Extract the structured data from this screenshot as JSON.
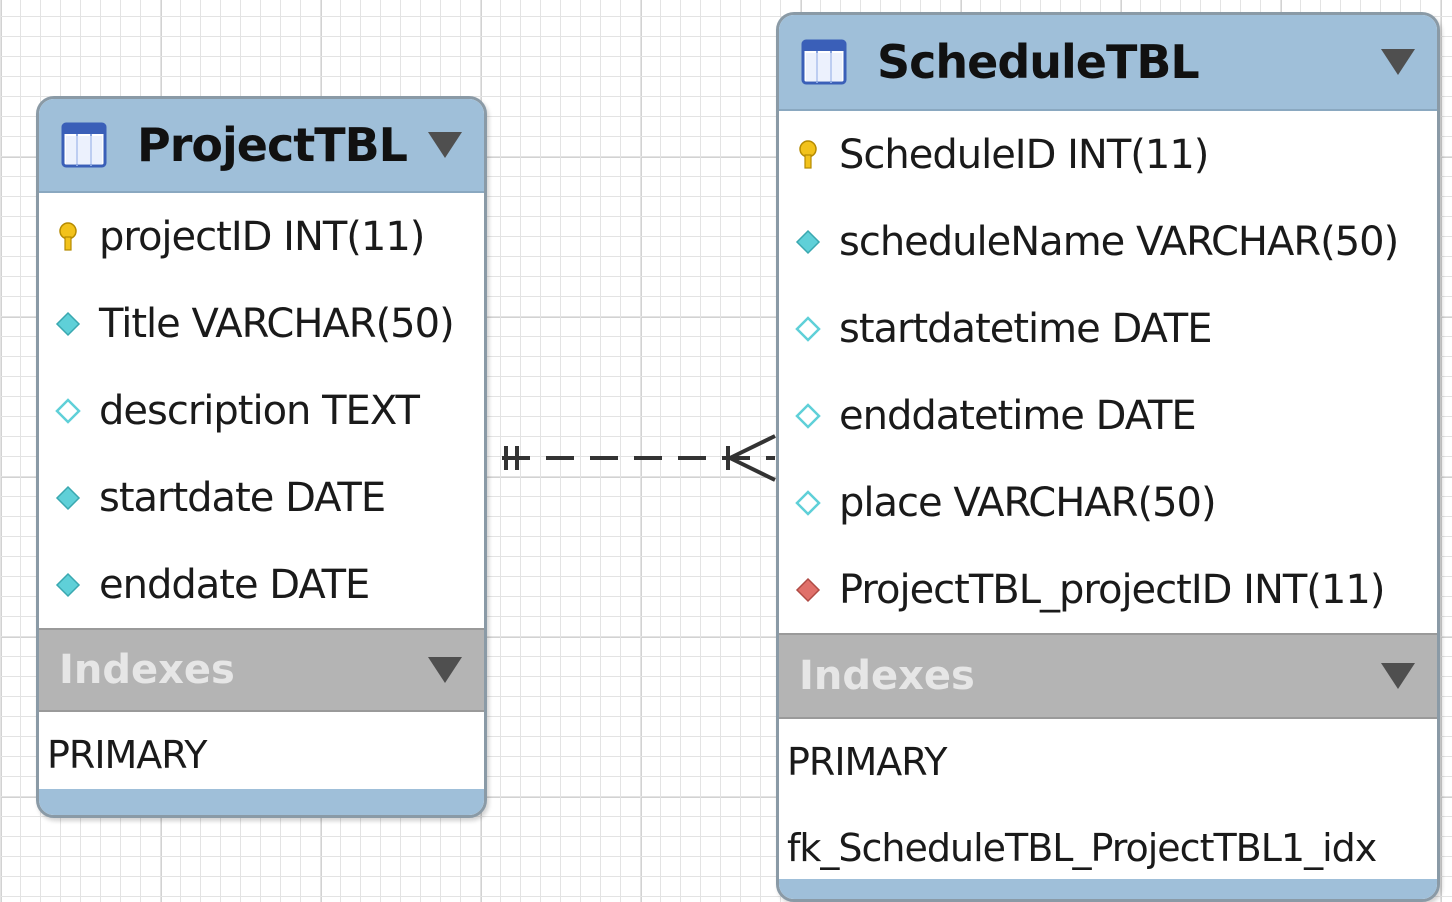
{
  "tables": {
    "project": {
      "name": "ProjectTBL",
      "columns": [
        {
          "text": "projectID INT(11)",
          "icon": "primary-key-icon"
        },
        {
          "text": "Title VARCHAR(50)",
          "icon": "not-null-column-icon"
        },
        {
          "text": "description TEXT",
          "icon": "nullable-column-icon"
        },
        {
          "text": "startdate DATE",
          "icon": "not-null-column-icon"
        },
        {
          "text": "enddate DATE",
          "icon": "not-null-column-icon"
        }
      ],
      "indexes_label": "Indexes",
      "indexes": [
        "PRIMARY"
      ]
    },
    "schedule": {
      "name": "ScheduleTBL",
      "columns": [
        {
          "text": "ScheduleID INT(11)",
          "icon": "primary-key-icon"
        },
        {
          "text": "scheduleName VARCHAR(50)",
          "icon": "not-null-column-icon"
        },
        {
          "text": "startdatetime DATE",
          "icon": "nullable-column-icon"
        },
        {
          "text": "enddatetime DATE",
          "icon": "nullable-column-icon"
        },
        {
          "text": "place VARCHAR(50)",
          "icon": "nullable-column-icon"
        },
        {
          "text": "ProjectTBL_projectID INT(11)",
          "icon": "foreign-key-icon"
        }
      ],
      "indexes_label": "Indexes",
      "indexes": [
        "PRIMARY",
        "fk_ScheduleTBL_ProjectTBL1_idx"
      ]
    }
  },
  "relationship": {
    "from": "ProjectTBL",
    "to": "ScheduleTBL",
    "cardinality": "one-to-many",
    "style": "dashed"
  },
  "colors": {
    "header": "#9fbfd9",
    "section": "#b4b4b4",
    "key": "#f2c21b",
    "not_null": "#5fd0d8",
    "foreign_key": "#e0706a"
  }
}
